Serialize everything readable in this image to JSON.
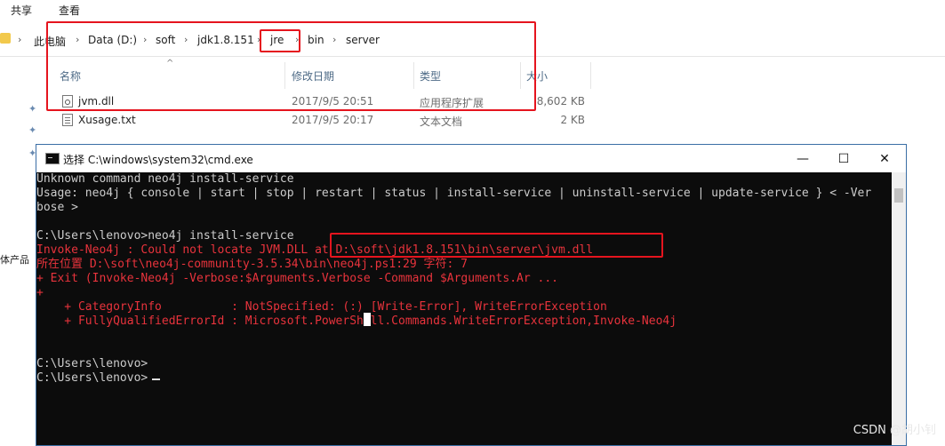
{
  "explorer": {
    "ribbon_tabs": [
      "共享",
      "查看"
    ],
    "breadcrumb": [
      "此电脑",
      "Data (D:)",
      "soft",
      "jdk1.8.151",
      "jre",
      "bin",
      "server"
    ],
    "breadcrumb_separator": "›",
    "columns": [
      "名称",
      "修改日期",
      "类型",
      "大小"
    ],
    "sort_indicator": "^",
    "files": [
      {
        "icon": "dll-file-icon",
        "name": "jvm.dll",
        "modified": "2017/9/5 20:51",
        "type": "应用程序扩展",
        "size": "8,602 KB"
      },
      {
        "icon": "text-file-icon",
        "name": "Xusage.txt",
        "modified": "2017/9/5 20:17",
        "type": "文本文档",
        "size": "2 KB"
      }
    ],
    "left_pane_label": "体产品",
    "pin_glyph": "✦"
  },
  "cmd_window": {
    "title": "选择 C:\\windows\\system32\\cmd.exe",
    "controls": {
      "minimize": "—",
      "maximize": "☐",
      "close": "✕"
    },
    "lines": [
      {
        "text": "Unknown command neo4j install-service",
        "error": false
      },
      {
        "text": "Usage: neo4j { console | start | stop | restart | status | install-service | uninstall-service | update-service } < -Ver",
        "error": false
      },
      {
        "text": "bose >",
        "error": false
      },
      {
        "text": "",
        "error": false
      },
      {
        "text": "C:\\Users\\lenovo>neo4j install-service",
        "error": false
      },
      {
        "text": "Invoke-Neo4j : Could not locate JVM.DLL at D:\\soft\\jdk1.8.151\\bin\\server\\jvm.dll",
        "error": true
      },
      {
        "text": "所在位置 D:\\soft\\neo4j-community-3.5.34\\bin\\neo4j.ps1:29 字符: 7",
        "error": true
      },
      {
        "text": "+ Exit (Invoke-Neo4j -Verbose:$Arguments.Verbose -Command $Arguments.Ar ...",
        "error": true
      },
      {
        "text": "+",
        "error": true
      },
      {
        "text": "    + CategoryInfo          : NotSpecified: (:) [Write-Error], WriteErrorException",
        "error": true
      },
      {
        "text": "    + FullyQualifiedErrorId : Microsoft.PowerShell.Commands.WriteErrorException,Invoke-Neo4j",
        "error": true
      },
      {
        "text": "",
        "error": false
      },
      {
        "text": "",
        "error": false
      },
      {
        "text": "C:\\Users\\lenovo>",
        "error": false
      },
      {
        "text": "C:\\Users\\lenovo>",
        "error": false
      }
    ]
  },
  "watermark": "CSDN @胡小钊",
  "colors": {
    "highlight": "#e5141e",
    "console_bg": "#0c0c0c",
    "console_text": "#cccccc",
    "console_error": "#e8333c"
  }
}
